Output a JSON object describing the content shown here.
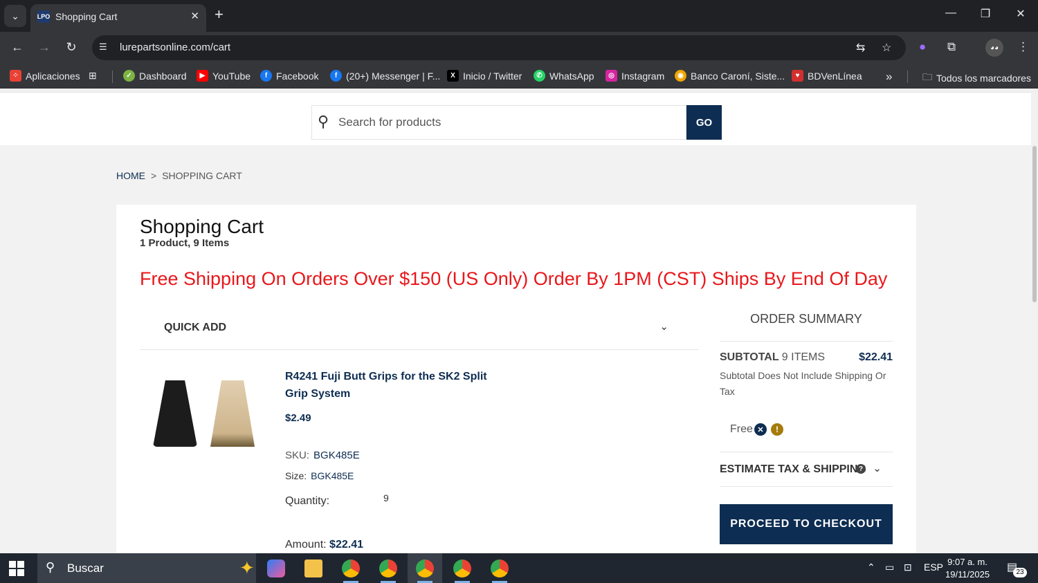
{
  "browser": {
    "tab_title": "Shopping Cart",
    "tab_favicon_text": "LPO",
    "url": "lurepartsonline.com/cart",
    "bookmarks": [
      {
        "label": "Aplicaciones",
        "icon": "apps-grid-icon",
        "color": "#e94235"
      },
      {
        "label": "Dashboard",
        "icon": "dashboard-icon",
        "color": "#7cb342"
      },
      {
        "label": "YouTube",
        "icon": "youtube-icon",
        "color": "#ff0000"
      },
      {
        "label": "Facebook",
        "icon": "facebook-icon",
        "color": "#1877f2"
      },
      {
        "label": "(20+) Messenger | F...",
        "icon": "facebook-icon",
        "color": "#1877f2"
      },
      {
        "label": "Inicio / Twitter",
        "icon": "x-icon",
        "color": "#000000"
      },
      {
        "label": "WhatsApp",
        "icon": "whatsapp-icon",
        "color": "#25d366"
      },
      {
        "label": "Instagram",
        "icon": "instagram-icon",
        "color": "#d6249f"
      },
      {
        "label": "Banco Caroní, Siste...",
        "icon": "bank-icon",
        "color": "#f0a500"
      },
      {
        "label": "BDVenLínea",
        "icon": "bdv-icon",
        "color": "#d32f2f"
      }
    ],
    "all_bookmarks_label": "Todos los marcadores"
  },
  "search": {
    "placeholder": "Search for products",
    "go_label": "GO"
  },
  "breadcrumb": {
    "home": "HOME",
    "separator": ">",
    "current": "SHOPPING CART"
  },
  "cart": {
    "title": "Shopping Cart",
    "subtitle": "1 Product, 9 Items",
    "promo": "Free Shipping On Orders Over $150 (US Only) Order By 1PM (CST) Ships By End Of Day",
    "quick_add_label": "QUICK ADD",
    "item": {
      "name": "R4241 Fuji Butt Grips for the SK2 Split Grip System",
      "price": "$2.49",
      "sku_label": "SKU:",
      "sku": "BGK485E",
      "size_label": "Size:",
      "size": "BGK485E",
      "quantity_label": "Quantity:",
      "quantity": "9",
      "amount_label": "Amount:",
      "amount": "$22.41"
    }
  },
  "summary": {
    "title": "ORDER SUMMARY",
    "subtotal_label": "SUBTOTAL",
    "subtotal_items": "9 ITEMS",
    "subtotal_value": "$22.41",
    "note": "Subtotal Does Not Include Shipping Or Tax",
    "shipping_text": "Free",
    "estimate_label": "ESTIMATE TAX & SHIPPING",
    "checkout_label": "PROCEED TO CHECKOUT"
  },
  "taskbar": {
    "search_label": "Buscar",
    "language": "ESP",
    "time": "9:07 a. m.",
    "date": "19/11/2025",
    "notifications": "23"
  },
  "colors": {
    "brand_navy": "#0e2d52",
    "promo_red": "#e8171b",
    "warning_gold": "#a57b0b"
  }
}
